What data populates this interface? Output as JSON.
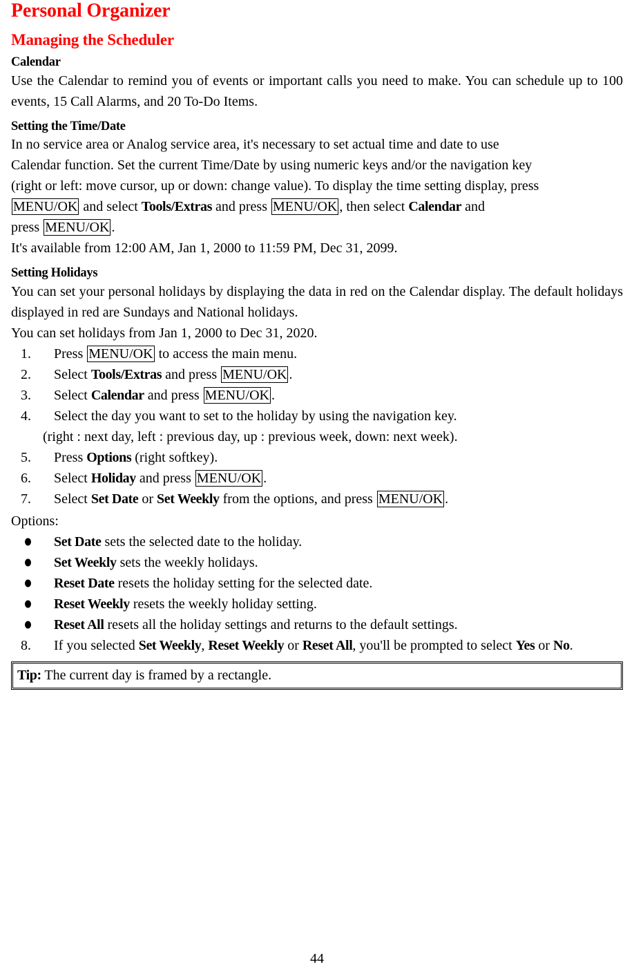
{
  "document": {
    "title": "Personal Organizer",
    "section_title": "Managing the Scheduler",
    "page_number": "44",
    "accent_color": "#ff0000",
    "text_color": "#000000"
  },
  "calendar": {
    "heading": "Calendar",
    "intro": "Use the Calendar to remind you of events or important calls you need to make. You can schedule up to 100 events, 15 Call Alarms, and 20 To-Do Items."
  },
  "time_date": {
    "heading": "Setting the Time/Date",
    "line1": "In no service area or Analog service area, it's necessary to set actual time and date to use",
    "line2": "Calendar function. Set the current Time/Date by using numeric keys and/or the navigation key",
    "line3": "(right or left: move cursor, up or down: change value). To display the time setting display, press",
    "l4_key1": "MENU/OK",
    "l4_mid1": " and select ",
    "l4_bold1": "Tools/Extras",
    "l4_mid2": " and press ",
    "l4_key2": "MENU/OK",
    "l4_mid3": ", then select ",
    "l4_bold2": "Calendar",
    "l4_end": " and",
    "l5_pre": "press ",
    "l5_key": "MENU/OK",
    "l5_end": ".",
    "availability": "It's available from 12:00 AM, Jan 1, 2000 to 11:59 PM, Dec 31, 2099."
  },
  "holidays": {
    "heading": "Setting Holidays",
    "para1": "You can set your personal holidays by displaying the data in red on the Calendar display. The default holidays displayed in red are Sundays and National holidays.",
    "para2": "You can set holidays from Jan 1, 2000 to Dec 31, 2020.",
    "steps": [
      {
        "num": "1.",
        "pre": "Press ",
        "key": "MENU/OK",
        "post": " to access the main menu."
      },
      {
        "num": "2.",
        "pre": "Select ",
        "bold": "Tools/Extras",
        "mid": " and press ",
        "key": "MENU/OK",
        "post": "."
      },
      {
        "num": "3.",
        "pre": "Select ",
        "bold": "Calendar",
        "mid": " and press ",
        "key": "MENU/OK",
        "post": "."
      },
      {
        "num": "4.",
        "pre": "Select the day you want to set to the holiday by using the navigation key."
      },
      {
        "num": "5.",
        "pre": "Press ",
        "bold": "Options",
        "post": " (right softkey)."
      },
      {
        "num": "6.",
        "pre": "Select ",
        "bold": "Holiday",
        "mid": " and press ",
        "key": "MENU/OK",
        "post": "."
      },
      {
        "num": "7.",
        "pre": "Select ",
        "bold": "Set Date",
        "mid": " or ",
        "bold2": "Set Weekly",
        "mid2": " from the options, and press ",
        "key": "MENU/OK",
        "post": "."
      }
    ],
    "step4_sub": "(right : next day, left : previous day, up : previous week, down: next week).",
    "options_label": "Options:",
    "options": [
      {
        "name": "Set Date",
        "desc": " sets the selected date to the holiday."
      },
      {
        "name": "Set Weekly",
        "desc": " sets the weekly holidays."
      },
      {
        "name": "Reset Date",
        "desc": " resets the holiday setting for the selected date."
      },
      {
        "name": "Reset Weekly",
        "desc": " resets the weekly holiday setting."
      },
      {
        "name": "Reset All",
        "desc": " resets all the holiday settings and returns to the default settings."
      }
    ],
    "step8": {
      "num": "8.",
      "pre": "If you selected ",
      "bold1": "Set Weekly",
      "mid1": ", ",
      "bold2": "Reset Weekly",
      "mid2": " or ",
      "bold3": "Reset All",
      "mid3": ", you'll be prompted to select ",
      "bold4": "Yes",
      "mid4": " or ",
      "bold5": "No",
      "post": "."
    }
  },
  "tip": {
    "label": "Tip:",
    "text": " The current day is framed by a rectangle."
  }
}
